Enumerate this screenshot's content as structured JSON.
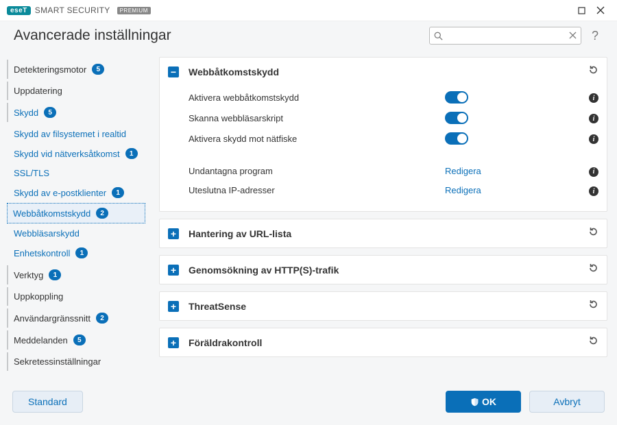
{
  "titlebar": {
    "brand_badge": "eseT",
    "brand_text": "SMART SECURITY",
    "brand_tier": "PREMIUM"
  },
  "header": {
    "title": "Avancerade inställningar",
    "search_placeholder": "",
    "help": "?"
  },
  "sidebar": {
    "items": [
      {
        "label": "Detekteringsmotor",
        "badge": "5",
        "top": true
      },
      {
        "label": "Uppdatering",
        "top": true
      },
      {
        "label": "Skydd",
        "badge": "5",
        "top": true,
        "link": true
      },
      {
        "label": "Skydd av filsystemet i realtid",
        "sub": true
      },
      {
        "label": "Skydd vid nätverksåtkomst",
        "badge": "1",
        "sub": true
      },
      {
        "label": "SSL/TLS",
        "sub": true
      },
      {
        "label": "Skydd av e-postklienter",
        "badge": "1",
        "sub": true
      },
      {
        "label": "Webbåtkomstskydd",
        "badge": "2",
        "sub": true,
        "selected": true
      },
      {
        "label": "Webbläsarskydd",
        "sub": true
      },
      {
        "label": "Enhetskontroll",
        "badge": "1",
        "sub": true
      },
      {
        "label": "Verktyg",
        "badge": "1",
        "top": true
      },
      {
        "label": "Uppkoppling",
        "top": true
      },
      {
        "label": "Användargränssnitt",
        "badge": "2",
        "top": true
      },
      {
        "label": "Meddelanden",
        "badge": "5",
        "top": true
      },
      {
        "label": "Sekretessinställningar",
        "top": true
      }
    ]
  },
  "panels": [
    {
      "title": "Webbåtkomstskydd",
      "expanded": true,
      "settings": [
        {
          "label": "Aktivera webbåtkomstskydd",
          "type": "toggle"
        },
        {
          "label": "Skanna webbläsarskript",
          "type": "toggle"
        },
        {
          "label": "Aktivera skydd mot nätfiske",
          "type": "toggle"
        },
        {
          "type": "gap"
        },
        {
          "label": "Undantagna program",
          "type": "link",
          "action": "Redigera"
        },
        {
          "label": "Uteslutna IP-adresser",
          "type": "link",
          "action": "Redigera"
        }
      ]
    },
    {
      "title": "Hantering av URL-lista",
      "expanded": false
    },
    {
      "title": "Genomsökning av HTTP(S)-trafik",
      "expanded": false
    },
    {
      "title": "ThreatSense",
      "expanded": false
    },
    {
      "title": "Föräldrakontroll",
      "expanded": false
    }
  ],
  "footer": {
    "default": "Standard",
    "ok": "OK",
    "cancel": "Avbryt"
  }
}
